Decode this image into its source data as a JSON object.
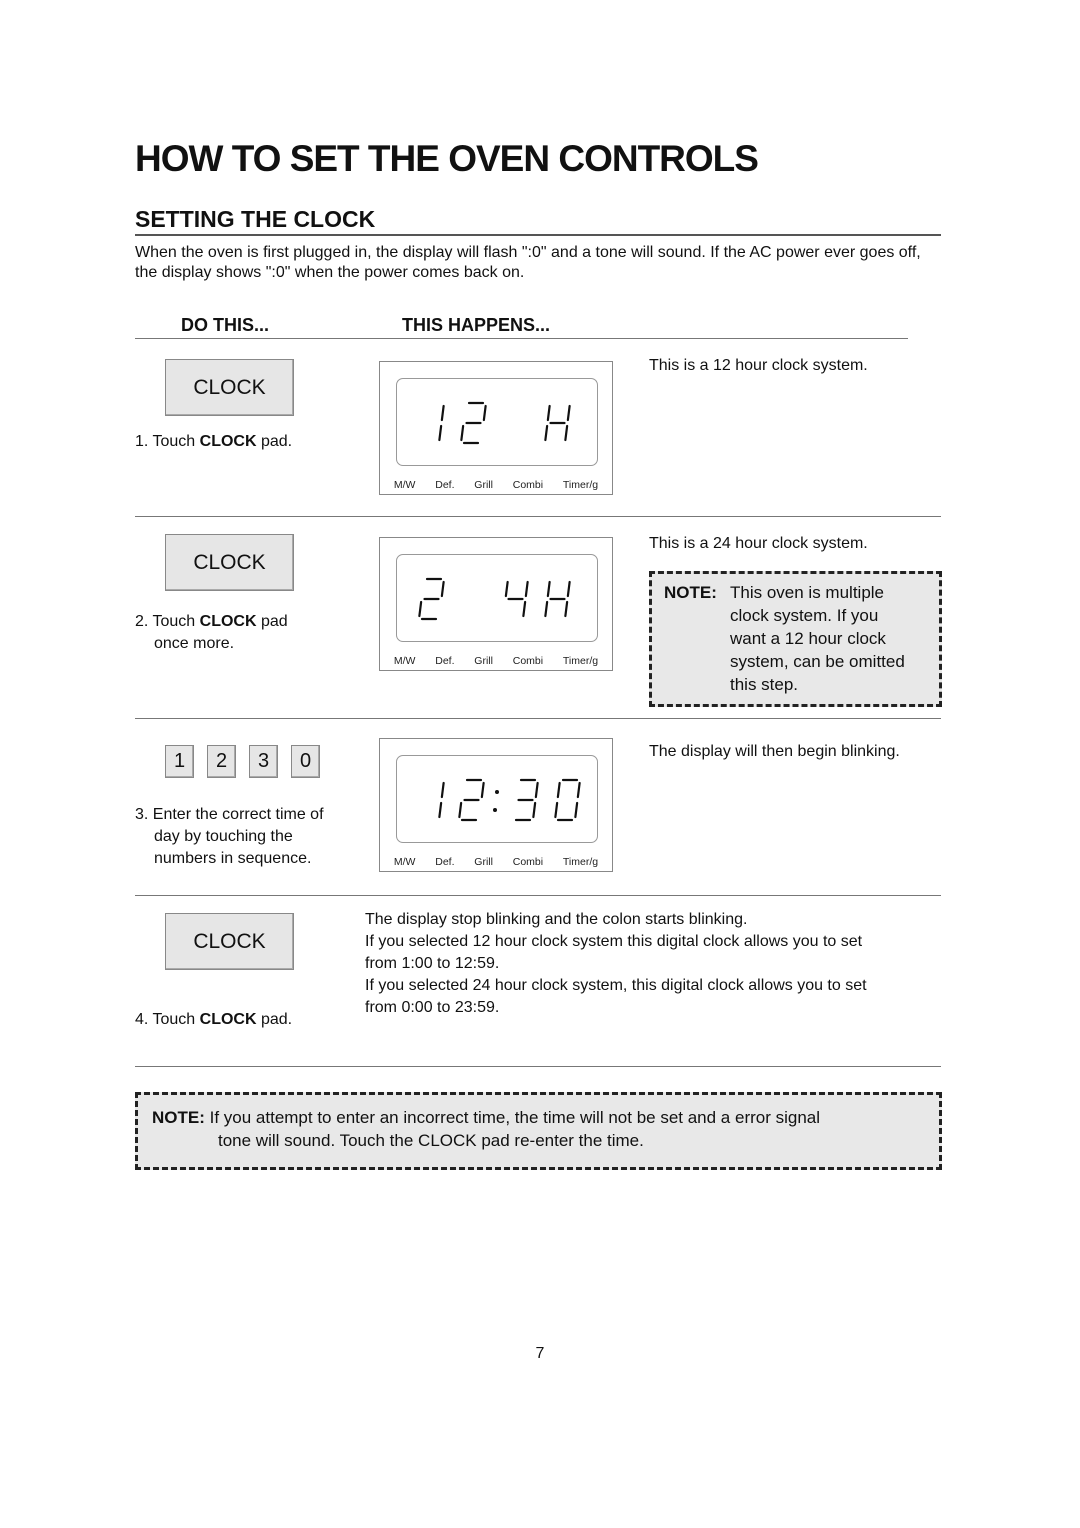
{
  "page": {
    "title": "HOW TO SET THE OVEN CONTROLS",
    "section_title": "SETTING THE CLOCK",
    "intro": "When the oven is first plugged in, the display will flash \":0\" and a tone will sound. If the AC power ever goes off, the display shows \":0\" when the power  comes back on.",
    "page_number": "7"
  },
  "columns": {
    "do_this": "DO THIS...",
    "this_happens": "THIS HAPPENS..."
  },
  "display_mode_labels": [
    "M/W",
    "Def.",
    "Grill",
    "Combi",
    "Timer/g"
  ],
  "steps": [
    {
      "pad_label": "CLOCK",
      "instruction_prefix": "1. Touch ",
      "instruction_bold": "CLOCK",
      "instruction_suffix": " pad.",
      "instruction_cont": "",
      "display": [
        "1",
        "2",
        " ",
        "H",
        " "
      ],
      "display_colon": false,
      "result": "This is a 12 hour clock system."
    },
    {
      "pad_label": "CLOCK",
      "instruction_prefix": "2. Touch ",
      "instruction_bold": "CLOCK",
      "instruction_suffix": " pad",
      "instruction_cont": "once more.",
      "display": [
        "2",
        " ",
        "4",
        "H",
        " "
      ],
      "display_colon": false,
      "result": "This is a 24 hour clock system.",
      "note": {
        "label": "NOTE:",
        "lines": [
          "This oven is multiple",
          "clock system. If you",
          "want a 12 hour clock",
          "system, can be omitted",
          "this step."
        ]
      }
    },
    {
      "number_pads": [
        "1",
        "2",
        "3",
        "0"
      ],
      "instruction_lines": [
        "3. Enter the correct time of",
        "day by touching the",
        "numbers in sequence."
      ],
      "display": [
        "1",
        "2",
        "3",
        "0"
      ],
      "display_colon": true,
      "result": "The display will then begin blinking."
    },
    {
      "pad_label": "CLOCK",
      "instruction_prefix": "4. Touch ",
      "instruction_bold": "CLOCK",
      "instruction_suffix": " pad.",
      "result_lines": [
        "The display stop blinking and the colon starts blinking.",
        "If you selected 12 hour clock system this digital clock allows you to set",
        "from 1:00 to 12:59.",
        "If you selected 24 hour clock system, this digital clock allows you to set",
        "from 0:00 to 23:59."
      ]
    }
  ],
  "bottom_note": {
    "label": "NOTE:",
    "line1": " If you attempt to enter an incorrect time, the time will not be set and a error signal",
    "line2": "tone will sound. Touch the CLOCK pad re-enter the time."
  }
}
